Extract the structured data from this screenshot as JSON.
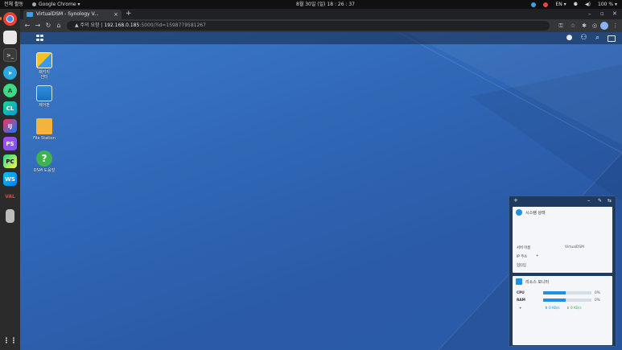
{
  "topbar": {
    "activities": "전체 활동",
    "app_name": "Google Chrome ▾",
    "clock": "8월 30일 (일)  18 : 26 : 37",
    "lang": "EN ▾",
    "battery": "100 % ▾"
  },
  "chrome": {
    "tab_title": "VirtualDSM - Synology V...",
    "tab_close": "×",
    "new_tab": "+",
    "omnibox": {
      "warning": "주의 요함",
      "host": "192.168.0.185",
      "path": ":5000/?id=1598779581267"
    }
  },
  "dsm": {
    "desktop_icons": [
      {
        "label": "패키지\n센터",
        "name": "package-center"
      },
      {
        "label": "제어판",
        "name": "control-panel"
      },
      {
        "label": "File Station",
        "name": "file-station"
      },
      {
        "label": "DSM 도움말",
        "name": "dsm-help"
      }
    ],
    "widgets": {
      "system_health": {
        "title": "시스템 상태",
        "server_name_label": "서버 이름",
        "server_name_value": "VirtualDSM",
        "ip_label": "IP 주소",
        "uptime_label": "업타임"
      },
      "resource_monitor": {
        "title": "리소스 모니터",
        "cpu_label": "CPU",
        "cpu_value": "0%",
        "cpu_fill": 0.46,
        "ram_label": "RAM",
        "ram_value": "0%",
        "ram_fill": 0.46,
        "upload": "0 KB/s",
        "download": "0 KB/s"
      }
    }
  },
  "colors": {
    "dsm_bg": "#2f66b5",
    "accent": "#1e90e8",
    "dock_accent": "#e96e2e"
  }
}
